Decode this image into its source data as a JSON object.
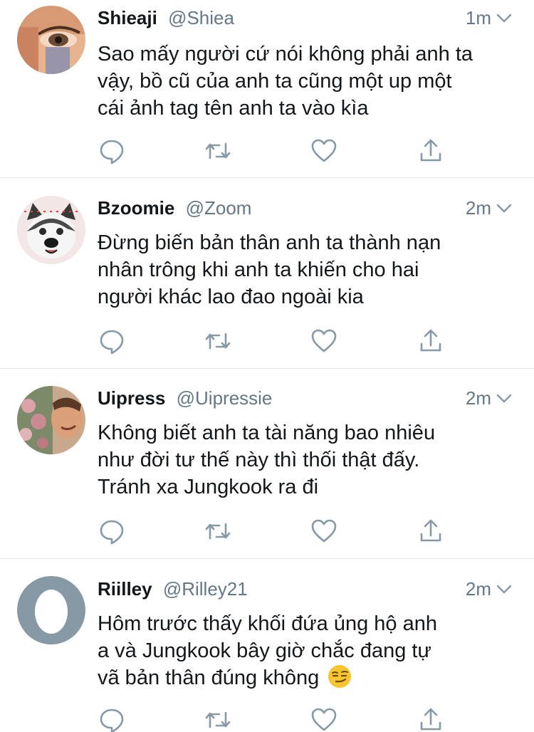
{
  "tweets": [
    {
      "name": "Shieaji",
      "handle": "@Shiea",
      "time": "1m",
      "lines": [
        "Sao mấy người cứ nói không phải anh ta",
        "vậy, bồ cũ của anh ta cũng một up một",
        "cái ảnh tag tên anh ta vào kìa"
      ],
      "avatar": "photo-avatar-eye"
    },
    {
      "name": "Bzoomie",
      "handle": "@Zoom",
      "time": "2m",
      "lines": [
        "Đừng biến bản thân anh ta thành nạn",
        "nhân trông khi anh ta khiến cho hai",
        "người khác lao đao ngoài kia"
      ],
      "avatar": "photo-avatar-husky"
    },
    {
      "name": "Uipress",
      "handle": "@Uipressie",
      "time": "2m",
      "lines": [
        "Không biết anh ta tài năng bao nhiêu",
        "như đời tư thế này thì thối thật đấy.",
        "Tránh xa Jungkook ra đi"
      ],
      "avatar": "photo-avatar-flowers"
    },
    {
      "name": "Riilley",
      "handle": "@Rilley21",
      "time": "2m",
      "lines": [
        "Hôm trước thấy khối đứa ủng hộ anh",
        "a và Jungkook bây giờ chắc đang tự",
        "vã bản thân đúng không"
      ],
      "avatar": "default-egg-avatar",
      "emoji": "smirking-face-emoji"
    }
  ],
  "colors": {
    "text": "#14171a",
    "secondary": "#657786",
    "divider": "#e1e8ed",
    "default_avatar_bg": "#8899a6"
  },
  "icons": [
    "reply-icon",
    "retweet-icon",
    "like-icon",
    "share-icon",
    "chevron-down-icon"
  ]
}
